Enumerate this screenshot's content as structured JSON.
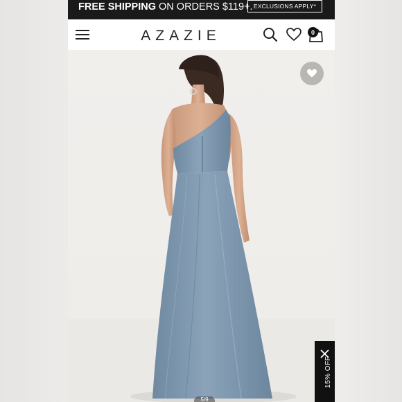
{
  "promo": {
    "highlight": "FREE SHIPPING",
    "text": " ON ORDERS $119+.",
    "exclusions_label": "EXCLUSIONS APPLY*"
  },
  "header": {
    "logo": "AZAZIE",
    "cart_count": "0"
  },
  "icons": {
    "menu": "menu-icon",
    "search": "search-icon",
    "wishlist": "heart-icon",
    "cart": "shopping-bag-icon",
    "close": "close-icon"
  },
  "discount_tab": {
    "label": "15% OFF"
  },
  "gallery": {
    "pager": "5/9"
  },
  "colors": {
    "promo_bar": "#1a1a1a",
    "dress": "#7b95ad",
    "wishlist_button": "#b9b7b4"
  }
}
